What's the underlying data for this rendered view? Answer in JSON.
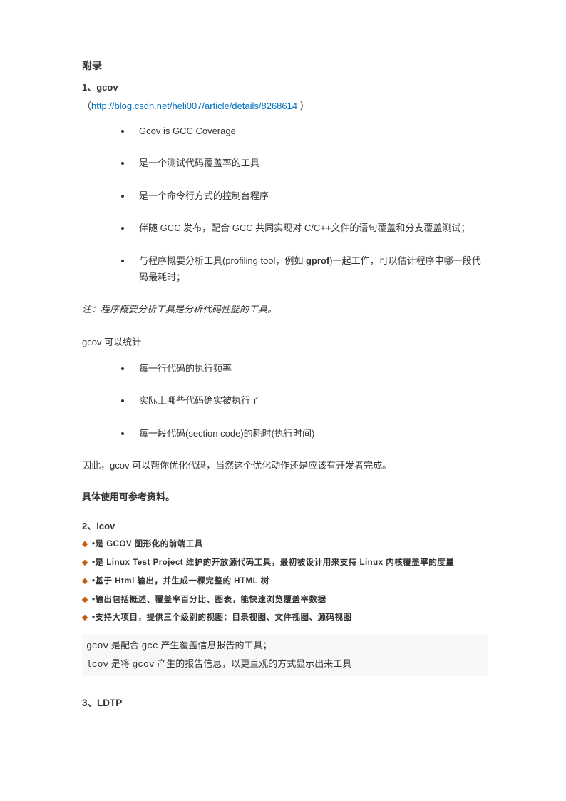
{
  "title": "附录",
  "sections": {
    "s1": {
      "heading": "1、gcov",
      "link_prefix": "（",
      "link_text": "http://blog.csdn.net/heli007/article/details/8268614",
      "link_suffix": "  ）",
      "bullets1": [
        "Gcov is GCC Coverage",
        "是一个测试代码覆盖率的工具",
        "是一个命令行方式的控制台程序",
        "伴随 GCC 发布，配合 GCC 共同实现对 C/C++文件的语句覆盖和分支覆盖测试；",
        "与程序概要分析工具(profiling tool，例如 gprof)一起工作，可以估计程序中哪一段代码最耗时；"
      ],
      "note": "注：程序概要分析工具是分析代码性能的工具。",
      "para1": "gcov 可以统计",
      "bullets2": [
        "每一行代码的执行频率",
        "实际上哪些代码确实被执行了",
        "每一段代码(section code)的耗时(执行时间)"
      ],
      "para2": "因此，gcov 可以帮你优化代码，当然这个优化动作还是应该有开发者完成。",
      "para3": "具体使用可参考资料。"
    },
    "s2": {
      "heading": "2、lcov",
      "items": [
        "•是 GCOV 图形化的前端工具",
        "•是 Linux Test Project 维护的开放源代码工具，最初被设计用来支持 Linux 内核覆盖率的度量",
        "•基于 Html 输出，并生成一棵完整的 HTML 树",
        "•输出包括概述、覆盖率百分比、图表，能快速浏览覆盖率数据",
        "•支持大项目，提供三个级别的视图：目录视图、文件视图、源码视图"
      ],
      "code_line1": "gcov 是配合 gcc 产生覆盖信息报告的工具；",
      "code_line2": "lcov 是将 gcov 产生的报告信息，以更直观的方式显示出来工具"
    },
    "s3": {
      "heading": "3、LDTP"
    }
  }
}
